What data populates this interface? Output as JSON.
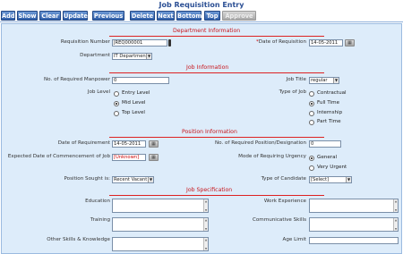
{
  "page": {
    "title": "Job Requisition Entry"
  },
  "toolbar": {
    "add": "Add",
    "show": "Show",
    "clear": "Clear",
    "update": "Update",
    "previous": "Previous",
    "delete": "Delete",
    "next": "Next",
    "bottom": "Bottom",
    "top": "Top",
    "approve": "Approve"
  },
  "sections": {
    "department": "Department Information",
    "job": "Job Information",
    "position": "Position Information",
    "spec": "Job Specification"
  },
  "department": {
    "req_no_label": "Requisition Number",
    "req_no_value": "JREQ000001",
    "date_label": "Date of Requisition",
    "date_value": "14-05-2011",
    "dept_label": "Department",
    "dept_value": "IT Department"
  },
  "job": {
    "manpower_label": "No. of Required Manpower",
    "manpower_value": "0",
    "title_label": "Job Title",
    "title_value": "regular",
    "level_label": "Job Level",
    "levels": [
      "Entry Level",
      "Mid Level",
      "Top Level"
    ],
    "type_label": "Type of Job",
    "types": [
      "Contractual",
      "Full Time",
      "Internship",
      "Part Time"
    ]
  },
  "position": {
    "req_date_label": "Date of Requirement",
    "req_date_value": "14-05-2011",
    "pos_count_label": "No. of Required Position/Designation",
    "pos_count_value": "0",
    "commence_label": "Expected Date of Commencement of Job",
    "commence_value": "[Unknown]",
    "urgency_label": "Mode of Requiring Urgency",
    "urgencies": [
      "General",
      "Very Urgent"
    ],
    "sought_label": "Position Sought is:",
    "sought_value": "Recent Vacant",
    "candidate_label": "Type of Candidate",
    "candidate_value": "[Select]"
  },
  "spec": {
    "education": "Education",
    "experience": "Work Experience",
    "training": "Training",
    "communicative": "Communicative Skills",
    "other": "Other Skills & Knowledge",
    "age": "Age Limit"
  },
  "colors": {
    "accent": "#2f5ea8",
    "section": "#c8151b",
    "panel": "#ddecfa"
  }
}
